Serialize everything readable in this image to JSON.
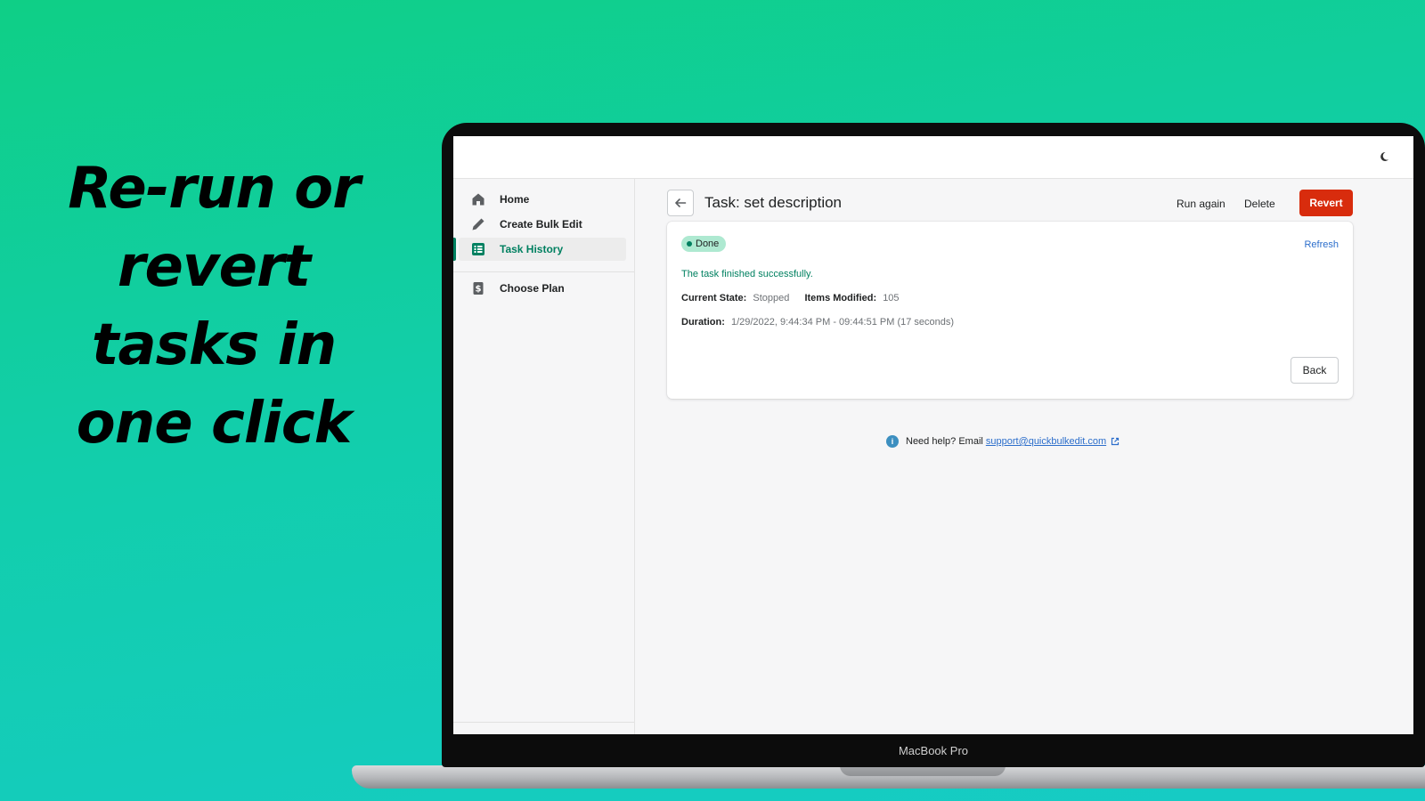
{
  "headline": [
    "Re-run or",
    "revert",
    "tasks in",
    "one click"
  ],
  "laptop": {
    "brand": "MacBook Pro"
  },
  "sidebar": {
    "items": [
      {
        "label": "Home",
        "icon": "home-icon"
      },
      {
        "label": "Create Bulk Edit",
        "icon": "pencil-icon"
      },
      {
        "label": "Task History",
        "icon": "list-icon",
        "active": true
      },
      {
        "label": "Choose Plan",
        "icon": "dollar-receipt-icon"
      }
    ]
  },
  "page": {
    "title": "Task: set description",
    "actions": {
      "run_again": "Run again",
      "delete": "Delete",
      "revert": "Revert"
    }
  },
  "card": {
    "status": "Done",
    "refresh": "Refresh",
    "message": "The task finished successfully.",
    "current_state_label": "Current State:",
    "current_state_value": "Stopped",
    "items_modified_label": "Items Modified:",
    "items_modified_value": "105",
    "duration_label": "Duration:",
    "duration_value": "1/29/2022, 9:44:34 PM - 09:44:51 PM (17 seconds)",
    "back": "Back"
  },
  "help": {
    "text": "Need help? Email",
    "email": "support@quickbulkedit.com"
  },
  "colors": {
    "accent": "#008060",
    "danger": "#d82c0d",
    "link": "#2c6ecb",
    "badge_bg": "#aee9d1"
  }
}
